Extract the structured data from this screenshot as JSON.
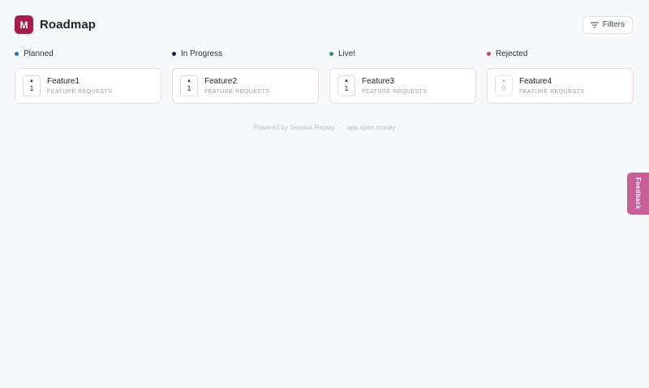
{
  "header": {
    "logo_letter": "M",
    "title": "Roadmap",
    "filters_label": "Filters",
    "filters_icon": "filter-lines-icon"
  },
  "columns": [
    {
      "label": "Planned",
      "color": "#2f6fb5",
      "cards": [
        {
          "title": "Feature1",
          "subtitle": "FEATURE REQUESTS",
          "votes": "1"
        }
      ]
    },
    {
      "label": "In Progress",
      "color": "#1b1f4d",
      "cards": [
        {
          "title": "Feature2",
          "subtitle": "FEATURE REQUESTS",
          "votes": "1"
        }
      ]
    },
    {
      "label": "Live!",
      "color": "#2e8b62",
      "cards": [
        {
          "title": "Feature3",
          "subtitle": "FEATURE REQUESTS",
          "votes": "1"
        }
      ]
    },
    {
      "label": "Rejected",
      "color": "#d0454c",
      "cards": [
        {
          "title": "Feature4",
          "subtitle": "FEATURE REQUESTS",
          "votes": "0"
        }
      ]
    }
  ],
  "footer": {
    "powered_by": "Powered by Session Replay",
    "separator": "·",
    "domain": "app.open.money"
  },
  "feedback_tab": {
    "label": "Feedback",
    "color": "#c95e98"
  },
  "upvote_icon": "▲",
  "brand_color": "#a61f4a"
}
